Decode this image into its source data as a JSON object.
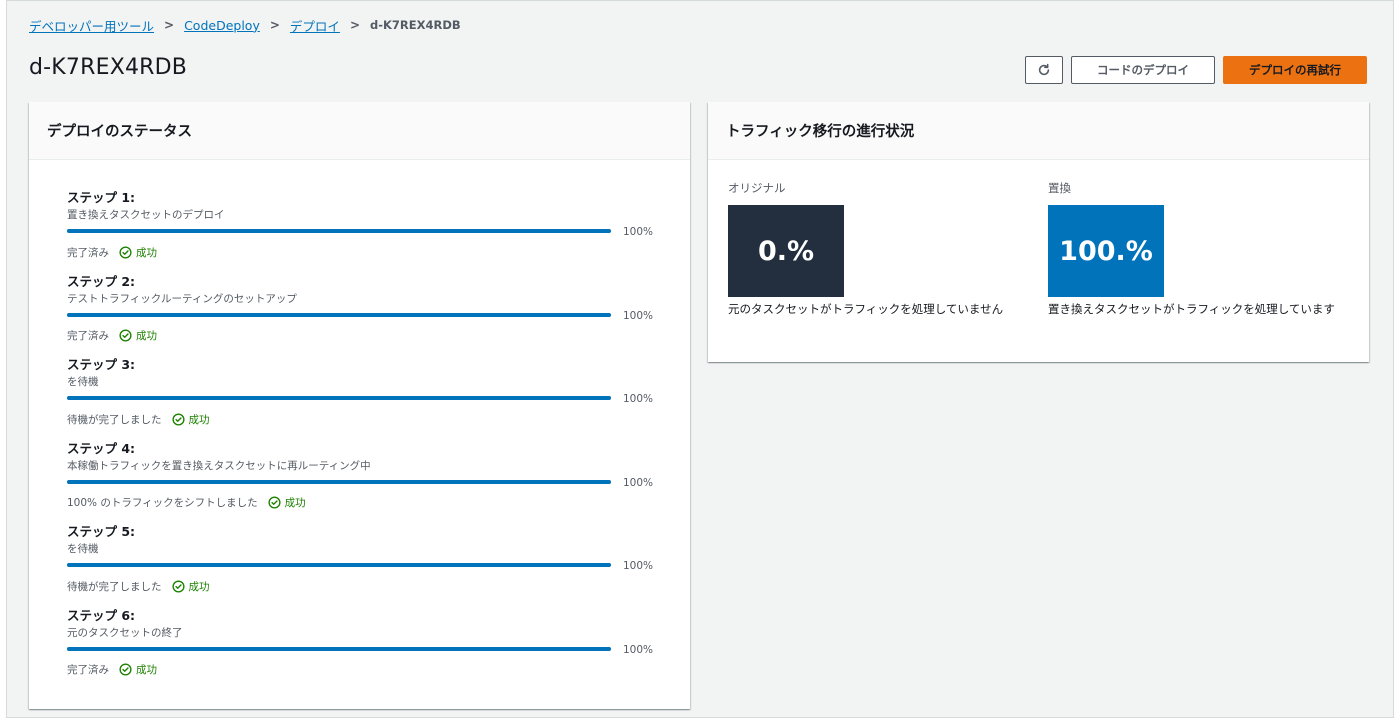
{
  "breadcrumb": {
    "items": [
      "デベロッパー用ツール",
      "CodeDeploy",
      "デプロイ"
    ],
    "current": "d-K7REX4RDB"
  },
  "header": {
    "title": "d-K7REX4RDB",
    "refresh_icon": "refresh-icon",
    "deploy_code_label": "コードのデプロイ",
    "retry_label": "デプロイの再試行"
  },
  "colors": {
    "accent": "#ec7211",
    "link": "#0073bb",
    "success": "#1d8102",
    "original_box": "#232f3e",
    "replacement_box": "#0073bb"
  },
  "status_panel": {
    "title": "デプロイのステータス",
    "success_label": "成功",
    "steps": [
      {
        "title": "ステップ 1:",
        "description": "置き換えタスクセットのデプロイ",
        "progress": 100,
        "progress_label": "100%",
        "state": "完了済み"
      },
      {
        "title": "ステップ 2:",
        "description": "テストトラフィックルーティングのセットアップ",
        "progress": 100,
        "progress_label": "100%",
        "state": "完了済み"
      },
      {
        "title": "ステップ 3:",
        "description": "を待機",
        "progress": 100,
        "progress_label": "100%",
        "state": "待機が完了しました"
      },
      {
        "title": "ステップ 4:",
        "description": "本稼働トラフィックを置き換えタスクセットに再ルーティング中",
        "progress": 100,
        "progress_label": "100%",
        "state": "100% のトラフィックをシフトしました"
      },
      {
        "title": "ステップ 5:",
        "description": "を待機",
        "progress": 100,
        "progress_label": "100%",
        "state": "待機が完了しました"
      },
      {
        "title": "ステップ 6:",
        "description": "元のタスクセットの終了",
        "progress": 100,
        "progress_label": "100%",
        "state": "完了済み"
      }
    ]
  },
  "traffic_panel": {
    "title": "トラフィック移行の進行状況",
    "original": {
      "label": "オリジナル",
      "value": "0.%",
      "description": "元のタスクセットがトラフィックを処理していません"
    },
    "replacement": {
      "label": "置換",
      "value": "100.%",
      "description": "置き換えタスクセットがトラフィックを処理しています"
    }
  }
}
